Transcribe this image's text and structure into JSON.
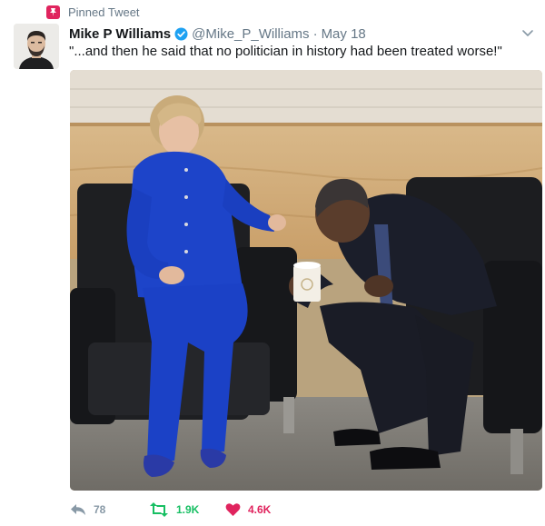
{
  "pinned_label": "Pinned Tweet",
  "author": {
    "name": "Mike P Williams",
    "handle": "@Mike_P_Williams",
    "verified": true
  },
  "separator": "·",
  "date": "May 18",
  "tweet_text": "\"...and then he said that no politician in history had been treated worse!\"",
  "actions": {
    "reply_count": "78",
    "retweet_count": "1.9K",
    "like_count": "4.6K"
  },
  "icons": {
    "pin": "pin-icon",
    "verified": "verified-badge-icon",
    "menu": "chevron-down-icon",
    "reply": "reply-icon",
    "retweet": "retweet-icon",
    "like": "heart-icon"
  },
  "colors": {
    "accent_blue": "#1da1f2",
    "retweet_green": "#17bf63",
    "like_red": "#e0245e",
    "muted_gray": "#657786"
  }
}
